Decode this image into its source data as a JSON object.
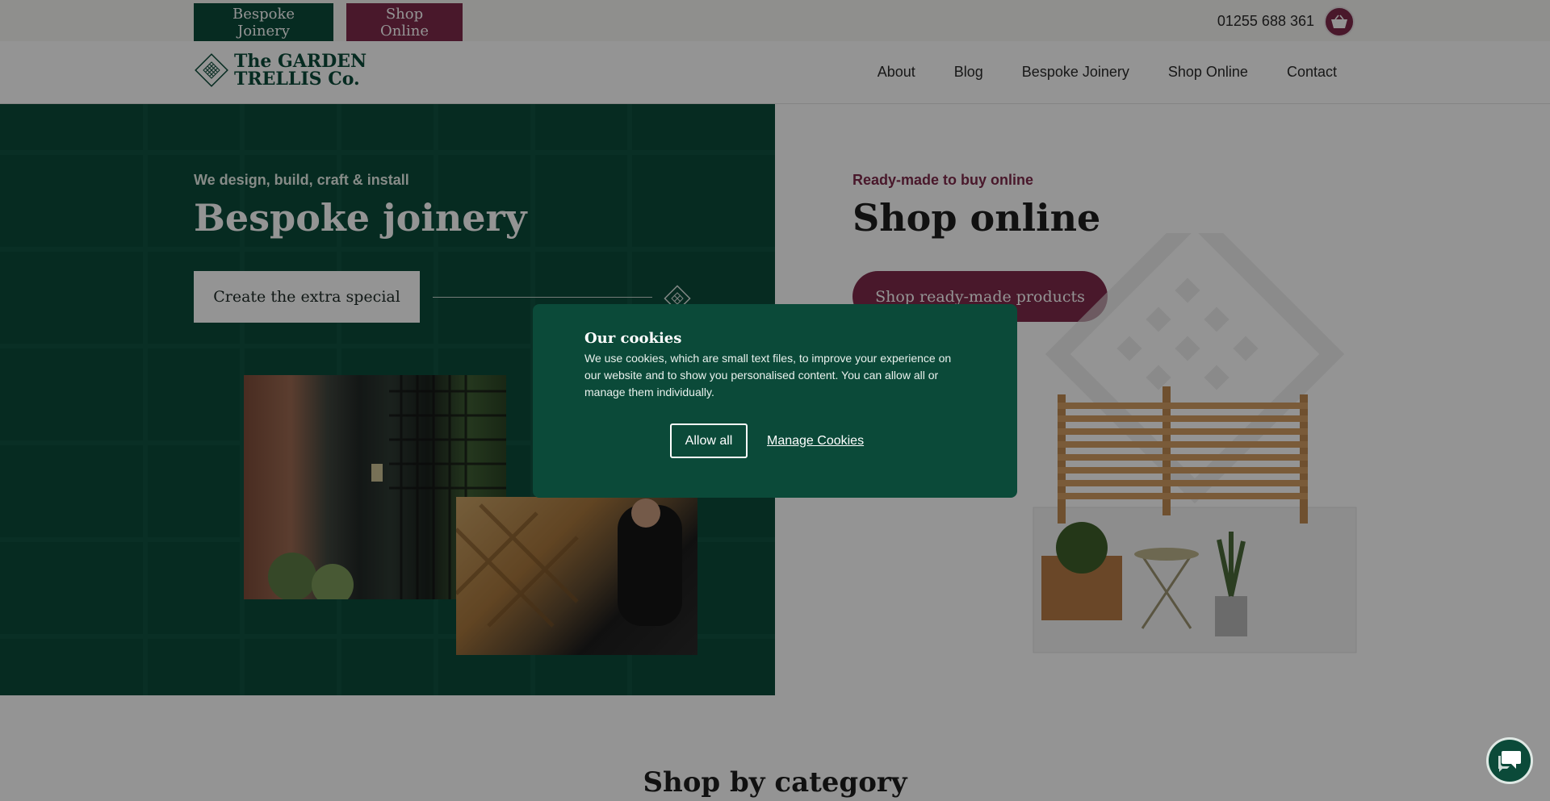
{
  "topbar": {
    "bespoke_joinery": "Bespoke Joinery",
    "shop_online": "Shop Online",
    "phone": "01255 688 361"
  },
  "logo": {
    "line1": "The GARDEN",
    "line2": "TRELLIS Co."
  },
  "nav": {
    "items": [
      "About",
      "Blog",
      "Bespoke Joinery",
      "Shop Online",
      "Contact"
    ]
  },
  "hero_left": {
    "eyebrow": "We design, build, craft & install",
    "title": "Bespoke joinery",
    "cta": "Create the extra special"
  },
  "hero_right": {
    "eyebrow": "Ready-made to buy online",
    "title": "Shop online",
    "cta": "Shop ready-made products"
  },
  "section": {
    "shop_by_category": "Shop by category"
  },
  "cookie_dialog": {
    "title": "Our cookies",
    "body": "We use cookies, which are small text files, to improve your experience on our website and to show you personalised content. You can allow all or manage them individually.",
    "allow_all": "Allow all",
    "manage": "Manage Cookies"
  },
  "colors": {
    "brand_green": "#0b4a39",
    "brand_plum": "#7e2a4b"
  },
  "icons": {
    "basket": "basket-icon",
    "chat": "chat-icon",
    "logo": "trellis-diamond-icon"
  }
}
